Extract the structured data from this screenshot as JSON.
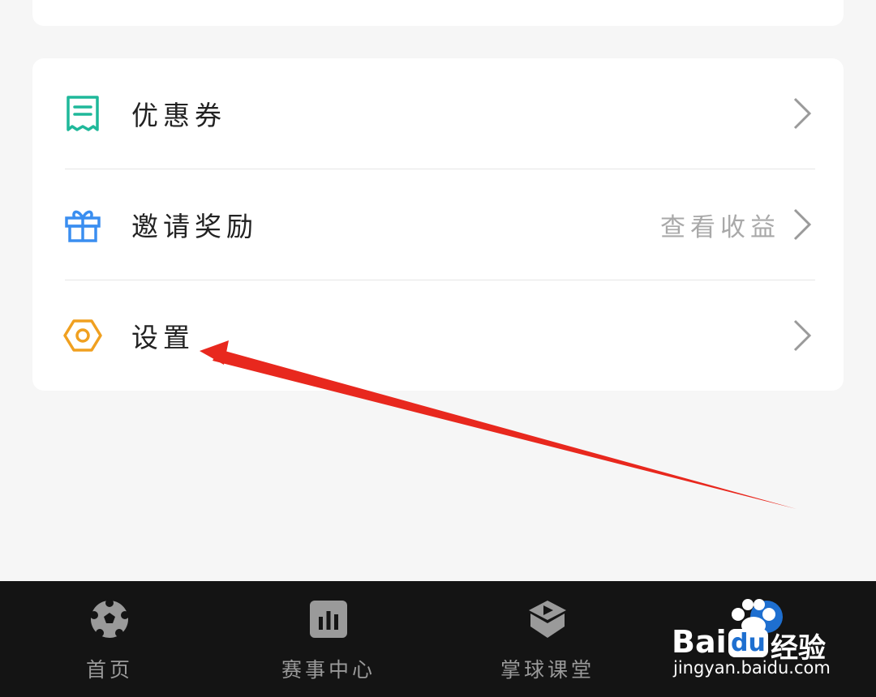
{
  "menu": {
    "items": [
      {
        "label": "优惠券",
        "extra": "",
        "icon": "receipt-icon",
        "color": "#1fb89a"
      },
      {
        "label": "邀请奖励",
        "extra": "查看收益",
        "icon": "gift-icon",
        "color": "#3a8ef0"
      },
      {
        "label": "设置",
        "extra": "",
        "icon": "hexagon-settings-icon",
        "color": "#f0a020"
      }
    ]
  },
  "tabbar": {
    "tabs": [
      {
        "label": "首页",
        "icon": "soccer-ball-icon"
      },
      {
        "label": "赛事中心",
        "icon": "bar-chart-icon"
      },
      {
        "label": "掌球课堂",
        "icon": "play-box-icon"
      },
      {
        "label": "",
        "icon": "profile-icon"
      }
    ]
  },
  "watermark": {
    "brand_left": "Bai",
    "brand_mid": "du",
    "brand_right": "经验",
    "url": "jingyan.baidu.com"
  },
  "annotation": {
    "type": "arrow",
    "color": "#e8281e",
    "points_to": "设置"
  }
}
